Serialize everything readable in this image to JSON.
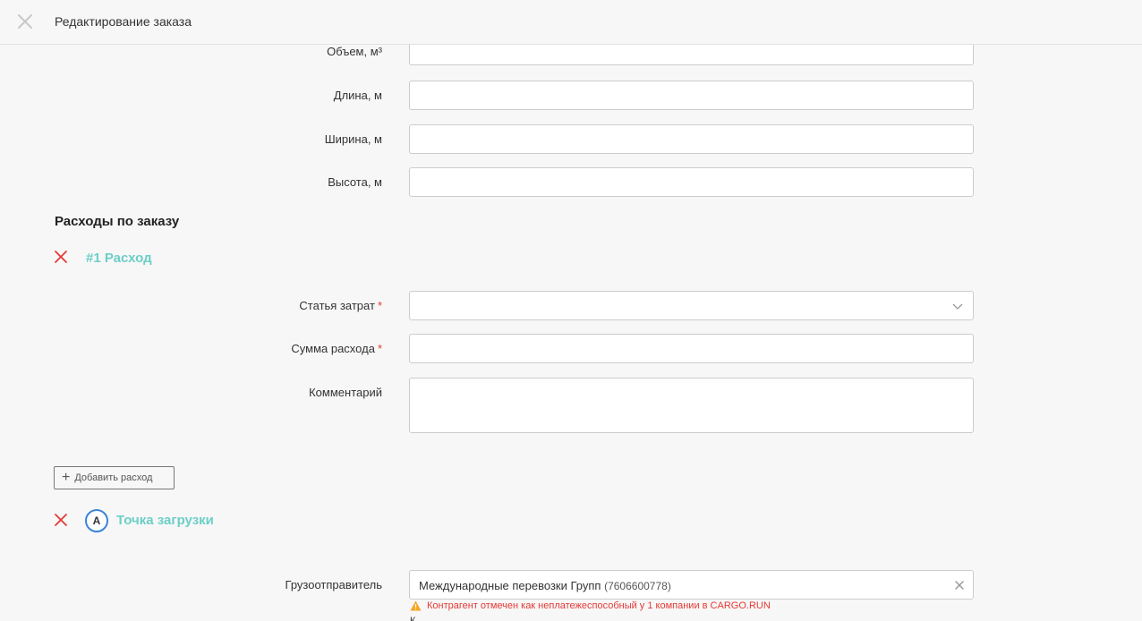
{
  "header": {
    "title": "Редактирование заказа"
  },
  "dimensions": {
    "volume_label": "Объем, м³",
    "length_label": "Длина, м",
    "width_label": "Ширина, м",
    "height_label": "Высота, м",
    "volume_value": "",
    "length_value": "",
    "width_value": "",
    "height_value": ""
  },
  "expenses": {
    "section_title": "Расходы по заказу",
    "item_title": "#1 Расход",
    "cost_item_label": "Статья затрат",
    "cost_item_value": "",
    "amount_label": "Сумма расхода",
    "amount_value": "",
    "comment_label": "Комментарий",
    "comment_value": "",
    "required_mark": "*",
    "add_button_label": "Добавить расход"
  },
  "loading_point": {
    "badge": "A",
    "title": "Точка загрузки",
    "shipper_label": "Грузоотправитель",
    "shipper_name": "Международные перевозки Групп",
    "shipper_inn": "(7606600778)",
    "warning": "Контрагент отмечен как неплатежеспособный у 1 компании в CARGO.RUN",
    "cut_text": "К"
  },
  "colors": {
    "accent_teal": "#6ccfc7",
    "danger_red": "#e53935",
    "badge_blue": "#3a85d8",
    "background": "#f7f7f7"
  },
  "icons": {
    "close": "close-icon",
    "remove": "remove-icon",
    "chevron": "chevron-down-icon",
    "plus": "plus-icon",
    "clear": "clear-icon",
    "warning": "warning-icon"
  }
}
